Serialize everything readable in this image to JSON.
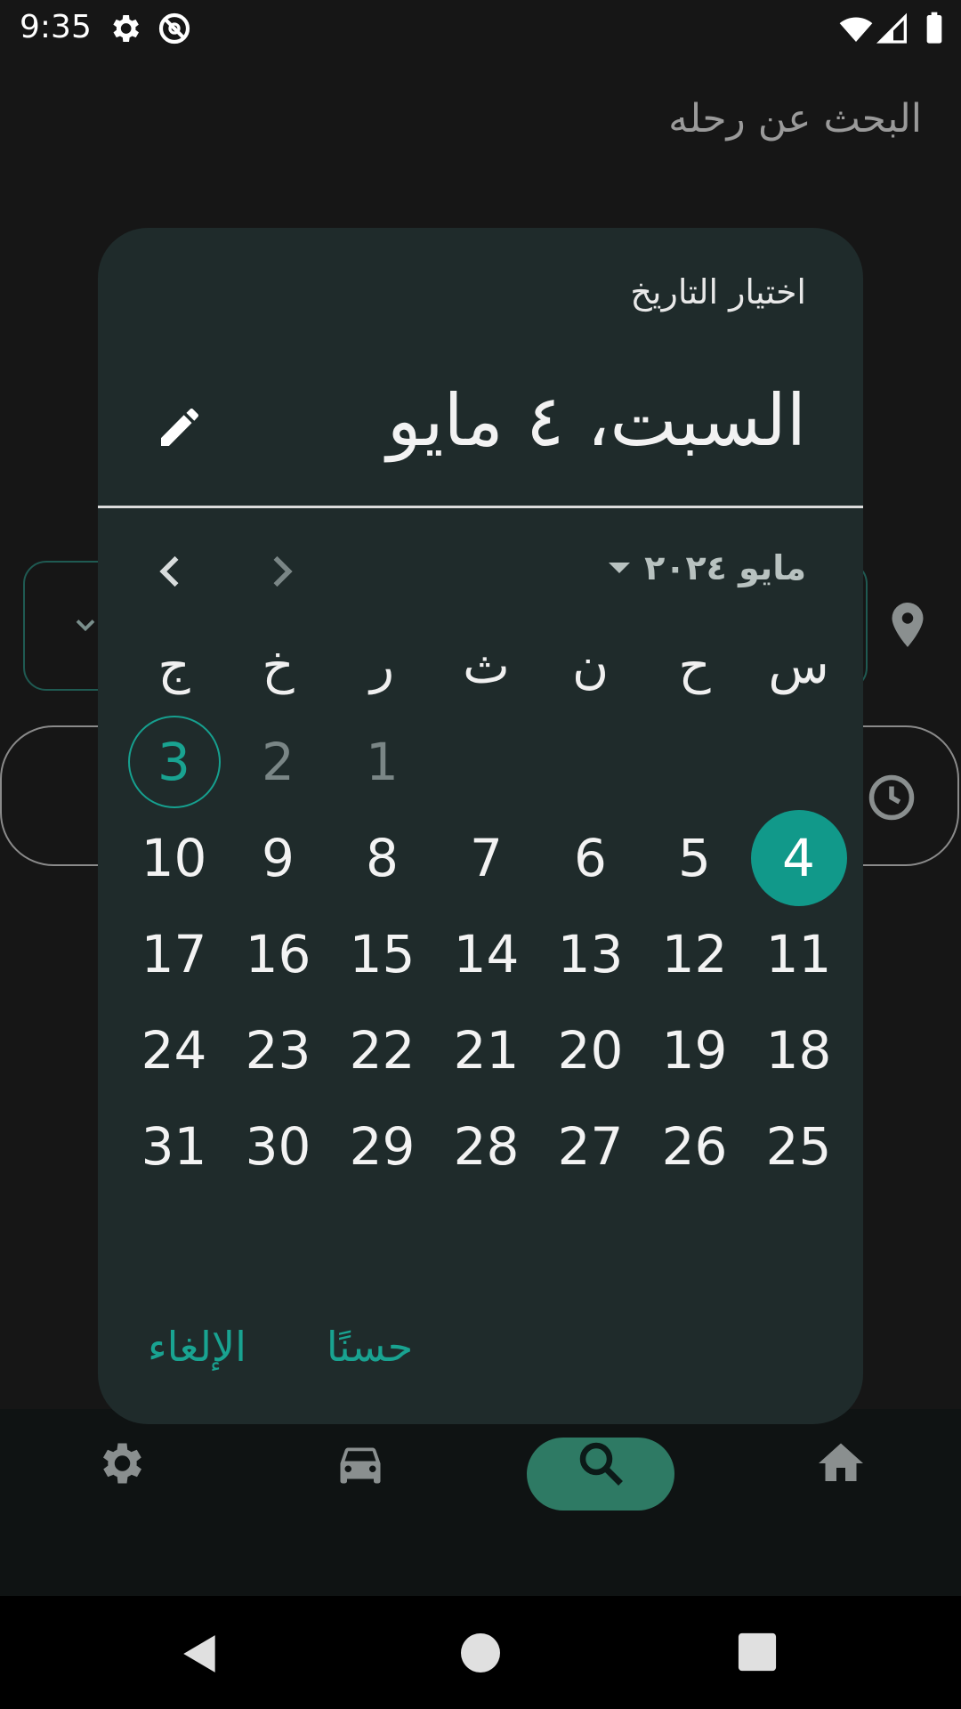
{
  "status_bar": {
    "time": "9:35",
    "icons": [
      "gear-icon",
      "no-data-icon",
      "wifi-icon",
      "signal-icon",
      "battery-icon"
    ]
  },
  "background": {
    "title": "البحث عن رحله",
    "nav": [
      {
        "name": "settings",
        "icon": "gear-icon"
      },
      {
        "name": "car",
        "icon": "car-icon"
      },
      {
        "name": "search",
        "icon": "search-icon",
        "active": true
      },
      {
        "name": "home",
        "icon": "home-icon"
      }
    ]
  },
  "dialog": {
    "title": "اختيار التاريخ",
    "selected_date": "السبت، ٤ مايو",
    "month_label": "مايو ٢٠٢٤",
    "weekdays": [
      "س",
      "ح",
      "ن",
      "ث",
      "ر",
      "خ",
      "ج"
    ],
    "weeks": [
      [
        "",
        "",
        "",
        "",
        "1",
        "2",
        "3"
      ],
      [
        "4",
        "5",
        "6",
        "7",
        "8",
        "9",
        "10"
      ],
      [
        "11",
        "12",
        "13",
        "14",
        "15",
        "16",
        "17"
      ],
      [
        "18",
        "19",
        "20",
        "21",
        "22",
        "23",
        "24"
      ],
      [
        "25",
        "26",
        "27",
        "28",
        "29",
        "30",
        "31"
      ]
    ],
    "today": "3",
    "selected": "4",
    "cancel_label": "الإلغاء",
    "ok_label": "حسنًا"
  },
  "colors": {
    "accent": "#11998a",
    "dialog_bg": "#1f2b2b"
  }
}
